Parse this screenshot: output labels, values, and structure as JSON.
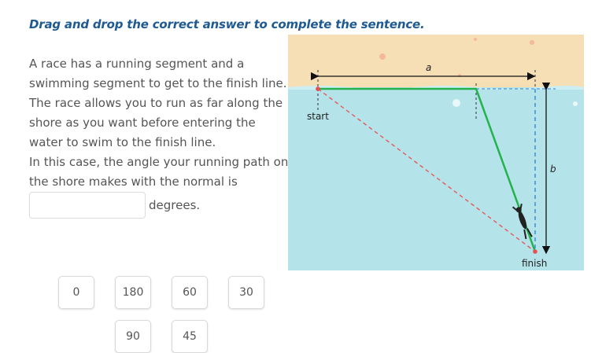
{
  "instruction": "Drag and drop the correct answer to complete the sentence.",
  "question": {
    "p1": "A race has a running segment and a swimming segment to get to the finish line. The race allows you to run as far along the shore as you want before entering the water to swim to the finish line.",
    "p2": "In this case, the angle your running path on the shore makes with the normal is",
    "after_blank": "degrees."
  },
  "figure": {
    "label_a": "a",
    "label_b": "b",
    "label_start": "start",
    "label_finish": "finish",
    "colors": {
      "sand": "#f6dfb5",
      "water": "#b5e3ea",
      "path": "#23b24b",
      "dashed_red": "#e85050",
      "dashed_blue": "#2c7fd6"
    }
  },
  "answers": [
    "0",
    "180",
    "60",
    "30",
    "90",
    "45"
  ]
}
